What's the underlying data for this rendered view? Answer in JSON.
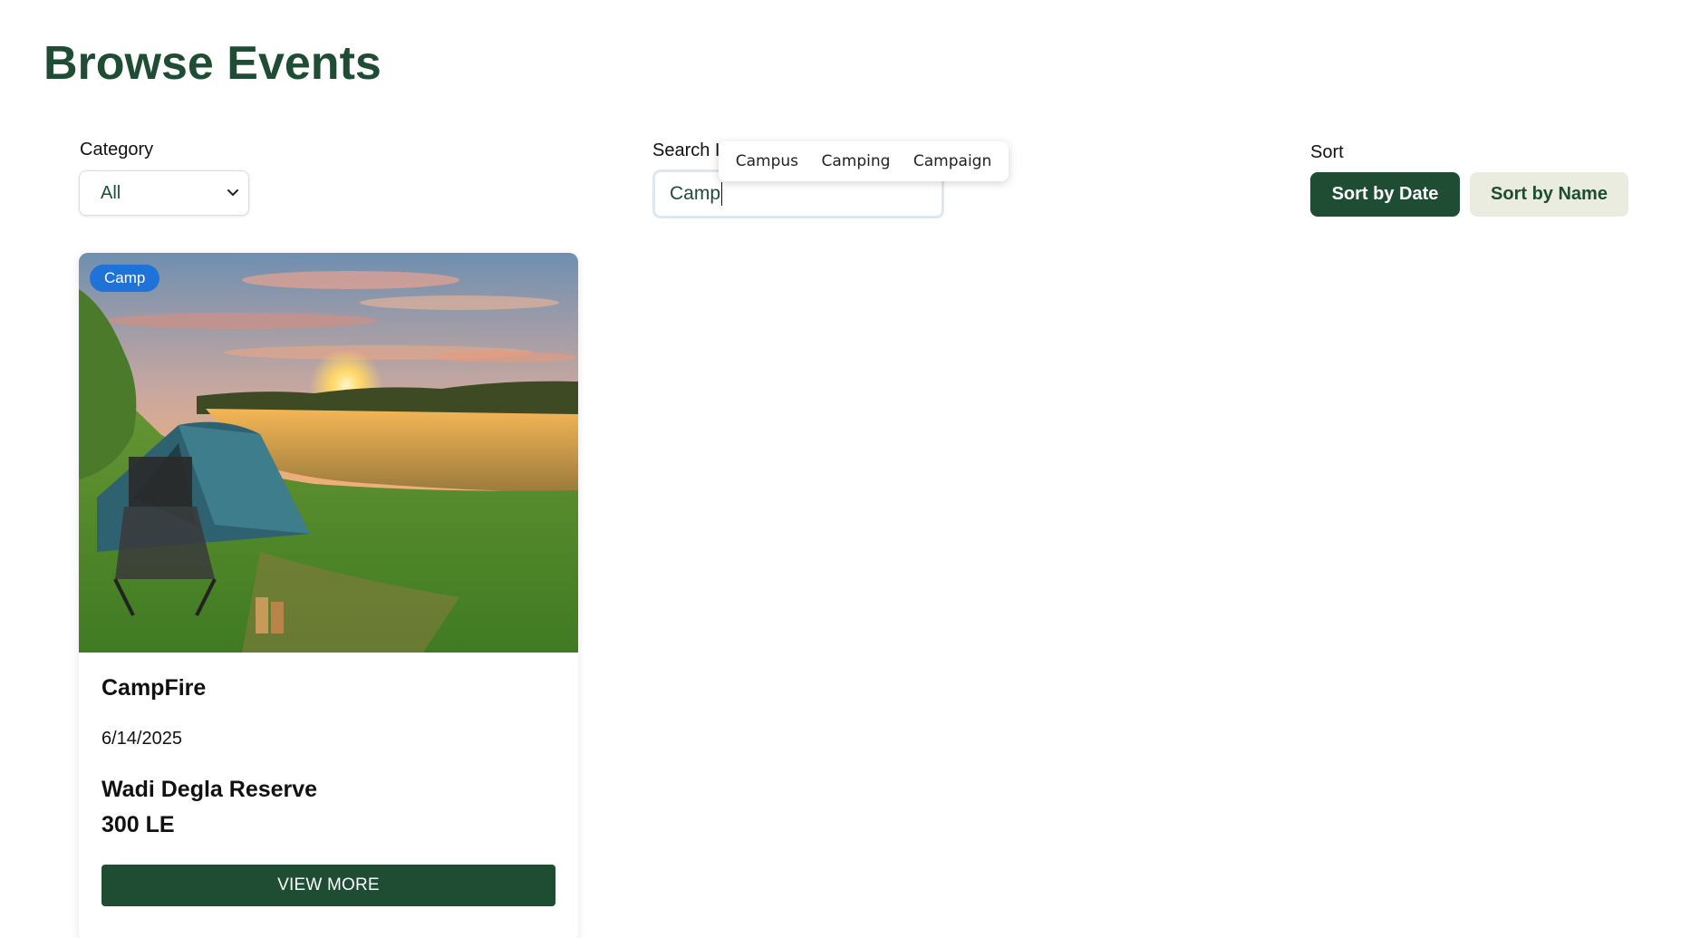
{
  "page": {
    "title": "Browse Events"
  },
  "filters": {
    "category": {
      "label": "Category",
      "selected": "All"
    },
    "search": {
      "label": "Search I",
      "value": "Camp",
      "suggestions": [
        "Campus",
        "Camping",
        "Campaign"
      ]
    },
    "sort": {
      "label": "Sort",
      "by_date_label": "Sort by Date",
      "by_name_label": "Sort by Name",
      "active": "Sort by Date"
    }
  },
  "events": [
    {
      "badge": "Camp",
      "name": "CampFire",
      "date": "6/14/2025",
      "location": "Wadi Degla Reserve",
      "price": "300 LE",
      "button_label": "VIEW MORE"
    }
  ],
  "colors": {
    "brand_green": "#1e4d33",
    "badge_blue": "#1f73d8",
    "secondary_button_bg": "#e9ecdf"
  },
  "icons": {
    "select_chevron": "chevron-down-icon"
  }
}
